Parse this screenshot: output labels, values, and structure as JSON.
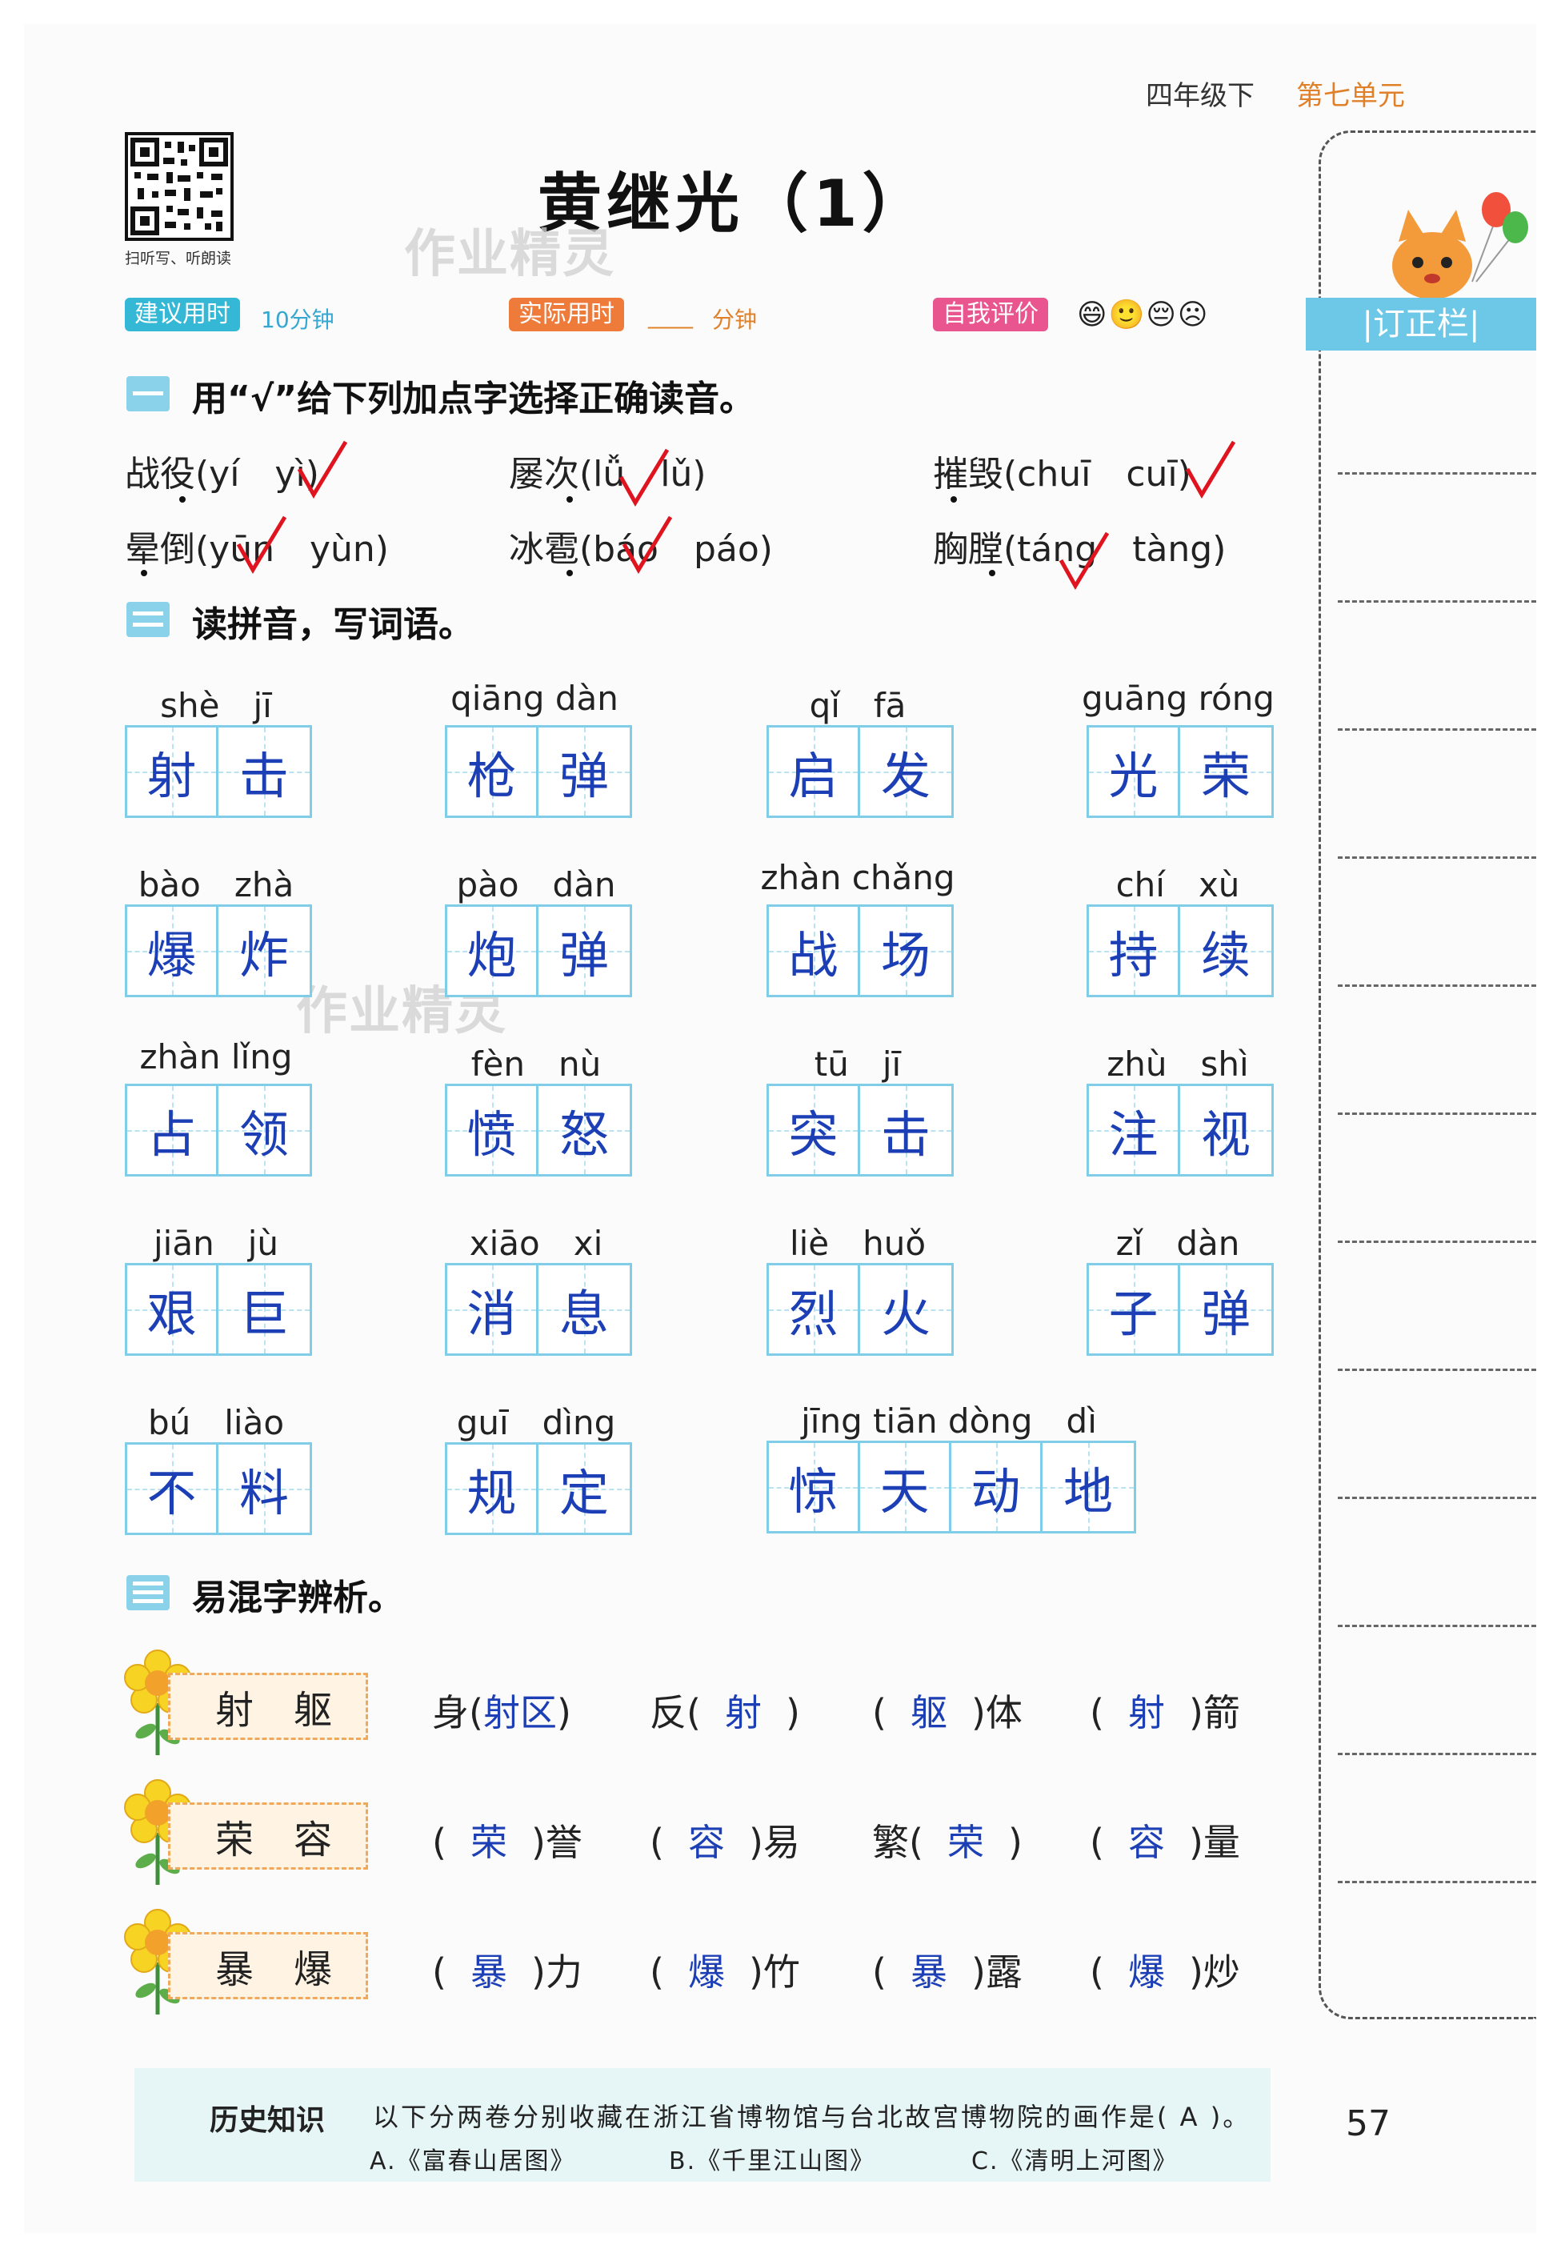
{
  "header": {
    "grade": "四年级下",
    "unit": "第七单元"
  },
  "qr_caption": "扫听写、听朗读",
  "title": "黄继光（1）",
  "watermark": "作业精灵",
  "meta": {
    "suggest_label": "建议用时",
    "suggest_value": "10分钟",
    "actual_label": "实际用时",
    "actual_blank": "____",
    "actual_unit": "分钟",
    "self_label": "自我评价",
    "faces": "😄🙂😔☹"
  },
  "section1": {
    "title": "用“√”给下列加点字选择正确读音。",
    "items": [
      {
        "text": "战役(yí　yì)"
      },
      {
        "text": "屡次(lǚ　lǔ)"
      },
      {
        "text": "摧毁(chuī　cuī)"
      },
      {
        "text": "晕倒(yūn　yùn)"
      },
      {
        "text": "冰雹(báo　páo)"
      },
      {
        "text": "胸膛(táng　tàng)"
      }
    ]
  },
  "section2": {
    "title": "读拼音，写词语。",
    "words": [
      {
        "pinyin": "shè　jī",
        "chars": [
          "射",
          "击"
        ]
      },
      {
        "pinyin": "qiāng dàn",
        "chars": [
          "枪",
          "弹"
        ]
      },
      {
        "pinyin": "qǐ　fā",
        "chars": [
          "启",
          "发"
        ]
      },
      {
        "pinyin": "guāng róng",
        "chars": [
          "光",
          "荣"
        ]
      },
      {
        "pinyin": "bào　zhà",
        "chars": [
          "爆",
          "炸"
        ]
      },
      {
        "pinyin": "pào　dàn",
        "chars": [
          "炮",
          "弹"
        ]
      },
      {
        "pinyin": "zhàn chǎng",
        "chars": [
          "战",
          "场"
        ]
      },
      {
        "pinyin": "chí　xù",
        "chars": [
          "持",
          "续"
        ]
      },
      {
        "pinyin": "zhàn lǐng",
        "chars": [
          "占",
          "领"
        ]
      },
      {
        "pinyin": "fèn　nù",
        "chars": [
          "愤",
          "怒"
        ]
      },
      {
        "pinyin": "tū　jī",
        "chars": [
          "突",
          "击"
        ]
      },
      {
        "pinyin": "zhù　shì",
        "chars": [
          "注",
          "视"
        ]
      },
      {
        "pinyin": "jiān　jù",
        "chars": [
          "艰",
          "巨"
        ]
      },
      {
        "pinyin": "xiāo　xi",
        "chars": [
          "消",
          "息"
        ]
      },
      {
        "pinyin": "liè　huǒ",
        "chars": [
          "烈",
          "火"
        ]
      },
      {
        "pinyin": "zǐ　dàn",
        "chars": [
          "子",
          "弹"
        ]
      },
      {
        "pinyin": "bú　liào",
        "chars": [
          "不",
          "料"
        ]
      },
      {
        "pinyin": "guī　dìng",
        "chars": [
          "规",
          "定"
        ]
      },
      {
        "pinyin": "jīng tiān dòng　dì",
        "chars": [
          "惊",
          "天",
          "动",
          "地"
        ]
      }
    ]
  },
  "section3": {
    "title": "易混字辨析。",
    "rows": [
      {
        "pair": [
          "射",
          "躯"
        ],
        "items": [
          {
            "pre": "身(",
            "ans": "射区",
            "post": ")"
          },
          {
            "pre": "反(",
            "ans": "射",
            "post": ")"
          },
          {
            "pre": "(",
            "ans": "躯",
            "post": ")体"
          },
          {
            "pre": "(",
            "ans": "射",
            "post": ")箭"
          }
        ]
      },
      {
        "pair": [
          "荣",
          "容"
        ],
        "items": [
          {
            "pre": "(",
            "ans": "荣",
            "post": ")誉"
          },
          {
            "pre": "(",
            "ans": "容",
            "post": ")易"
          },
          {
            "pre": "繁(",
            "ans": "荣",
            "post": ")"
          },
          {
            "pre": "(",
            "ans": "容",
            "post": ")量"
          }
        ]
      },
      {
        "pair": [
          "暴",
          "爆"
        ],
        "items": [
          {
            "pre": "(",
            "ans": "暴",
            "post": ")力"
          },
          {
            "pre": "(",
            "ans": "爆",
            "post": ")竹"
          },
          {
            "pre": "(",
            "ans": "暴",
            "post": ")露"
          },
          {
            "pre": "(",
            "ans": "爆",
            "post": ")炒"
          }
        ]
      }
    ]
  },
  "sidebar": {
    "label": "|订正栏|"
  },
  "footer": {
    "label": "历史知识",
    "question": "以下分两卷分别收藏在浙江省博物馆与台北故宫博物院的画作是( A )。",
    "options": [
      "A.《富春山居图》",
      "B.《千里江山图》",
      "C.《清明上河图》"
    ]
  },
  "page_number": "57",
  "colors": {
    "answer": "#1c3fb5",
    "grid": "#7fcde6",
    "check": "#e0141e",
    "accent": "#e0812a"
  }
}
